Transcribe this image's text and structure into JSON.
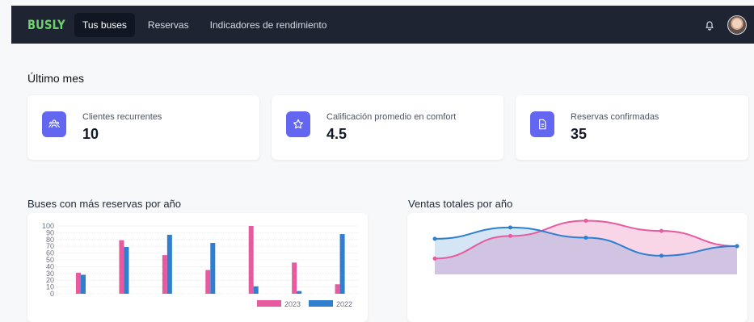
{
  "app": {
    "logo": "BUSLY",
    "nav": [
      "Tus buses",
      "Reservas",
      "Indicadores de rendimiento"
    ]
  },
  "section": {
    "title": "Último mes"
  },
  "cards": [
    {
      "label": "Clientes recurrentes",
      "value": "10",
      "icon": "users-icon"
    },
    {
      "label": "Calificación promedio en comfort",
      "value": "4.5",
      "icon": "star-icon"
    },
    {
      "label": "Reservas confirmadas",
      "value": "35",
      "icon": "document-icon"
    }
  ],
  "colors": {
    "nav_bg": "#1f2432",
    "accent": "#6366f1",
    "series_2023": "#e85aa0",
    "series_2022": "#2f7fd0"
  },
  "chart_data": [
    {
      "type": "bar",
      "title": "Buses con más reservas por año",
      "categories": [
        "",
        "",
        "",
        "",
        "",
        "",
        ""
      ],
      "ylim": [
        0,
        100
      ],
      "yticks": [
        0,
        10,
        20,
        30,
        40,
        50,
        60,
        70,
        80,
        90,
        100
      ],
      "legend": "bottom-right",
      "series": [
        {
          "name": "2023",
          "values": [
            31,
            79,
            57,
            35,
            100,
            46,
            14
          ]
        },
        {
          "name": "2022",
          "values": [
            28,
            69,
            87,
            75,
            11,
            4,
            88
          ]
        }
      ]
    },
    {
      "type": "area",
      "title": "Ventas totales por año",
      "x": [
        1,
        2,
        3,
        4,
        5
      ],
      "series": [
        {
          "name": "",
          "values": [
            28,
            68,
            95,
            77,
            50
          ]
        },
        {
          "name": "",
          "values": [
            63,
            83,
            65,
            33,
            50
          ]
        }
      ]
    }
  ]
}
